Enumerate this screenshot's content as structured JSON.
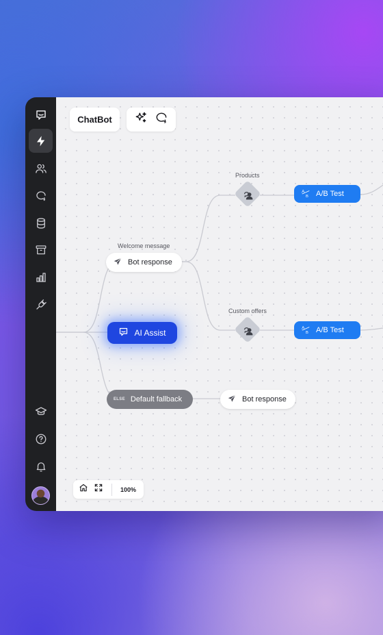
{
  "app": {
    "title": "ChatBot"
  },
  "sidebar": {
    "items": [
      {
        "icon": "chat-logo-icon"
      },
      {
        "icon": "lightning-icon",
        "active": true
      },
      {
        "icon": "users-icon"
      },
      {
        "icon": "chat-question-icon"
      },
      {
        "icon": "database-icon"
      },
      {
        "icon": "archive-icon"
      },
      {
        "icon": "bar-chart-icon"
      },
      {
        "icon": "plug-icon"
      }
    ],
    "bottom_items": [
      {
        "icon": "graduation-cap-icon"
      },
      {
        "icon": "help-circle-icon"
      },
      {
        "icon": "bell-icon"
      },
      {
        "icon": "avatar"
      }
    ]
  },
  "toolbar": {
    "tools": [
      {
        "icon": "sparkles-icon"
      },
      {
        "icon": "chat-question-icon"
      }
    ]
  },
  "flow": {
    "ai_assist": {
      "label": "AI Assist",
      "icon": "chat-icon"
    },
    "welcome": {
      "caption": "Welcome message",
      "label": "Bot response",
      "icon": "send-icon"
    },
    "products": {
      "caption": "Products",
      "icon": "user-condition-icon"
    },
    "custom_offers": {
      "caption": "Custom offers",
      "icon": "user-condition-icon"
    },
    "ab_test_1": {
      "label": "A/B Test",
      "icon": "ab-icon",
      "icon_a": "A",
      "icon_b": "B"
    },
    "ab_test_2": {
      "label": "A/B Test",
      "icon": "ab-icon",
      "icon_a": "A",
      "icon_b": "B"
    },
    "fallback": {
      "tag": "ELSE",
      "label": "Default fallback"
    },
    "fallback_response": {
      "label": "Bot response",
      "icon": "send-icon"
    }
  },
  "zoom": {
    "level": "100%",
    "icons": [
      "home-icon",
      "fit-screen-icon"
    ]
  },
  "colors": {
    "sidebar_bg": "#1f2023",
    "canvas_bg": "#f1f1f3",
    "ai_assist": "#1f46e0",
    "ab_test": "#1f7cf2",
    "fallback": "#7c7d84"
  }
}
